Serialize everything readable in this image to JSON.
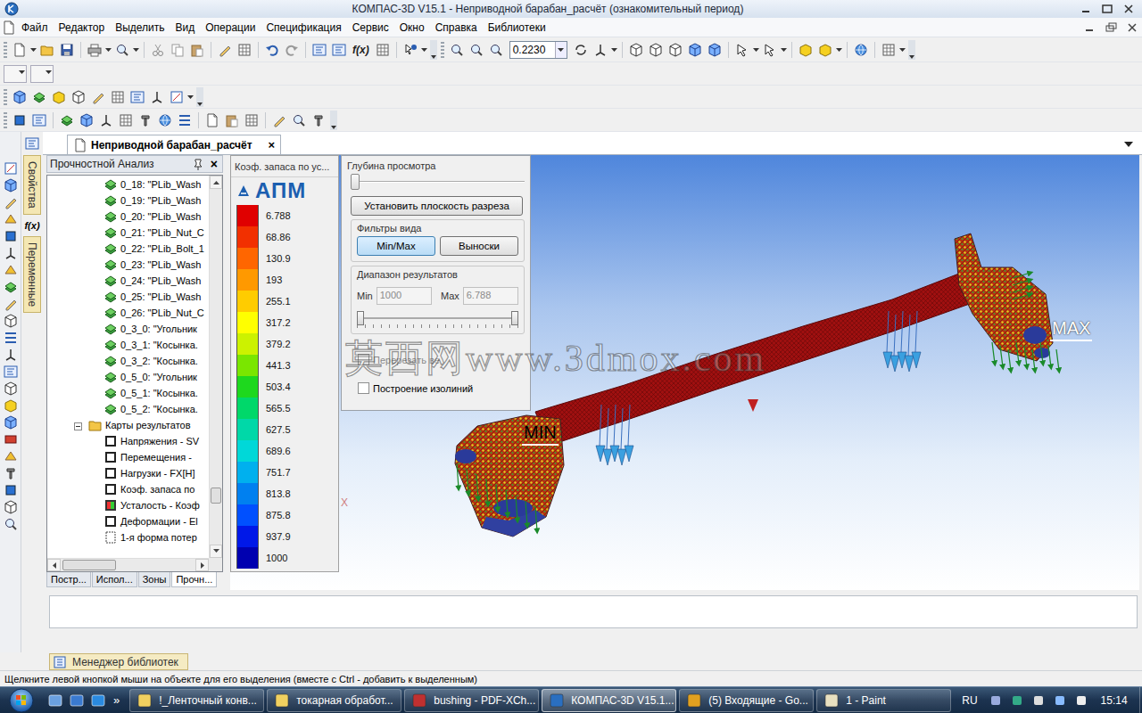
{
  "window": {
    "title": "КОМПАС-3D V15.1 - Неприводной барабан_расчёт (ознакомительный период)"
  },
  "menu": [
    "Файл",
    "Редактор",
    "Выделить",
    "Вид",
    "Операции",
    "Спецификация",
    "Сервис",
    "Окно",
    "Справка",
    "Библиотеки"
  ],
  "toolbar": {
    "fx": "f(x)",
    "zoom": "0.2230"
  },
  "side_tabs": {
    "properties": "Свойства",
    "fx": "f(x)",
    "variables": "Переменные"
  },
  "document_tab": {
    "label": "Неприводной барабан_расчёт",
    "close": "×",
    "selected": true
  },
  "tree_panel": {
    "title": "Прочностной Анализ",
    "close": "×",
    "items": [
      {
        "label": "0_18: \"PLib_Wash",
        "kind": "part"
      },
      {
        "label": "0_19: \"PLib_Wash",
        "kind": "part"
      },
      {
        "label": "0_20: \"PLib_Wash",
        "kind": "part"
      },
      {
        "label": "0_21: \"PLib_Nut_C",
        "kind": "part"
      },
      {
        "label": "0_22: \"PLib_Bolt_1",
        "kind": "part"
      },
      {
        "label": "0_23: \"PLib_Wash",
        "kind": "part"
      },
      {
        "label": "0_24: \"PLib_Wash",
        "kind": "part"
      },
      {
        "label": "0_25: \"PLib_Wash",
        "kind": "part"
      },
      {
        "label": "0_26: \"PLib_Nut_C",
        "kind": "part"
      },
      {
        "label": "0_3_0: \"Угольник",
        "kind": "part"
      },
      {
        "label": "0_3_1: \"Косынка.",
        "kind": "part"
      },
      {
        "label": "0_3_2: \"Косынка.",
        "kind": "part"
      },
      {
        "label": "0_5_0: \"Угольник",
        "kind": "part"
      },
      {
        "label": "0_5_1: \"Косынка.",
        "kind": "part"
      },
      {
        "label": "0_5_2: \"Косынка.",
        "kind": "part"
      },
      {
        "label": "Карты результатов",
        "kind": "folder",
        "expanded": true
      },
      {
        "label": "Напряжения - SV",
        "kind": "map"
      },
      {
        "label": "Перемещения -",
        "kind": "map"
      },
      {
        "label": "Нагрузки - FX[H]",
        "kind": "map"
      },
      {
        "label": "Коэф. запаса по",
        "kind": "map"
      },
      {
        "label": "Усталость - Коэф",
        "kind": "map-color"
      },
      {
        "label": "Деформации - El",
        "kind": "map"
      },
      {
        "label": "1-я форма потер",
        "kind": "form"
      }
    ],
    "vscroll_level": 0.88,
    "tabs": [
      {
        "label": "Постр...",
        "selected": false
      },
      {
        "label": "Испол...",
        "selected": false
      },
      {
        "label": "Зоны",
        "selected": false
      },
      {
        "label": "Прочн...",
        "selected": true
      }
    ]
  },
  "legend": {
    "title": "Коэф. запаса по ус...",
    "logo": "АПМ",
    "scale": [
      {
        "value": "6.788",
        "color": "#e00000"
      },
      {
        "value": "68.86",
        "color": "#f23000"
      },
      {
        "value": "130.9",
        "color": "#ff6600"
      },
      {
        "value": "193",
        "color": "#ff9900"
      },
      {
        "value": "255.1",
        "color": "#ffcc00"
      },
      {
        "value": "317.2",
        "color": "#ffff00"
      },
      {
        "value": "379.2",
        "color": "#ccf200"
      },
      {
        "value": "441.3",
        "color": "#7ae600"
      },
      {
        "value": "503.4",
        "color": "#1ed81e"
      },
      {
        "value": "565.5",
        "color": "#00d86a"
      },
      {
        "value": "627.5",
        "color": "#00d8a8"
      },
      {
        "value": "689.6",
        "color": "#00d8d8"
      },
      {
        "value": "751.7",
        "color": "#00b0ee"
      },
      {
        "value": "813.8",
        "color": "#0080f0"
      },
      {
        "value": "875.8",
        "color": "#0050ff"
      },
      {
        "value": "937.9",
        "color": "#0018e8"
      },
      {
        "value": "1000",
        "color": "#0000b0"
      }
    ]
  },
  "dialog": {
    "depth_label": "Глубина просмотра",
    "depth_level": 0,
    "section_button": "Установить плоскость разреза",
    "filters_label": "Фильтры вида",
    "filters": [
      {
        "label": "Min/Max",
        "selected": true
      },
      {
        "label": "Выноски",
        "selected": false
      }
    ],
    "range_label": "Диапазон результатов",
    "min_label": "Min",
    "min_value": "1000",
    "max_label": "Max",
    "max_value": "6.788",
    "range_disabled": true,
    "range_low": 0,
    "range_high": 1,
    "cut": {
      "label": "Перерезать ве",
      "checked": false,
      "disabled": true
    },
    "isolines": {
      "label": "Построение изолиний",
      "checked": false
    }
  },
  "viewport": {
    "min_label": "MIN",
    "max_label": "MAX",
    "axis_mark": "X"
  },
  "watermark": "莫西网www.3dmox.com",
  "library_tab": "Менеджер библиотек",
  "status_bar": "Щелкните левой кнопкой мыши на объекте для его выделения (вместе с Ctrl - добавить к выделенным)",
  "taskbar": {
    "quick_more": "»",
    "tasks": [
      {
        "label": "!_Ленточный конв...",
        "selected": false
      },
      {
        "label": "токарная обработ...",
        "selected": false
      },
      {
        "label": "bushing - PDF-XCh...",
        "selected": false
      },
      {
        "label": "КОМПАС-3D V15.1...",
        "selected": true
      },
      {
        "label": "(5) Входящие - Go...",
        "selected": false
      },
      {
        "label": "1 - Paint",
        "selected": false
      }
    ],
    "language": "RU",
    "clock": "15:14"
  }
}
